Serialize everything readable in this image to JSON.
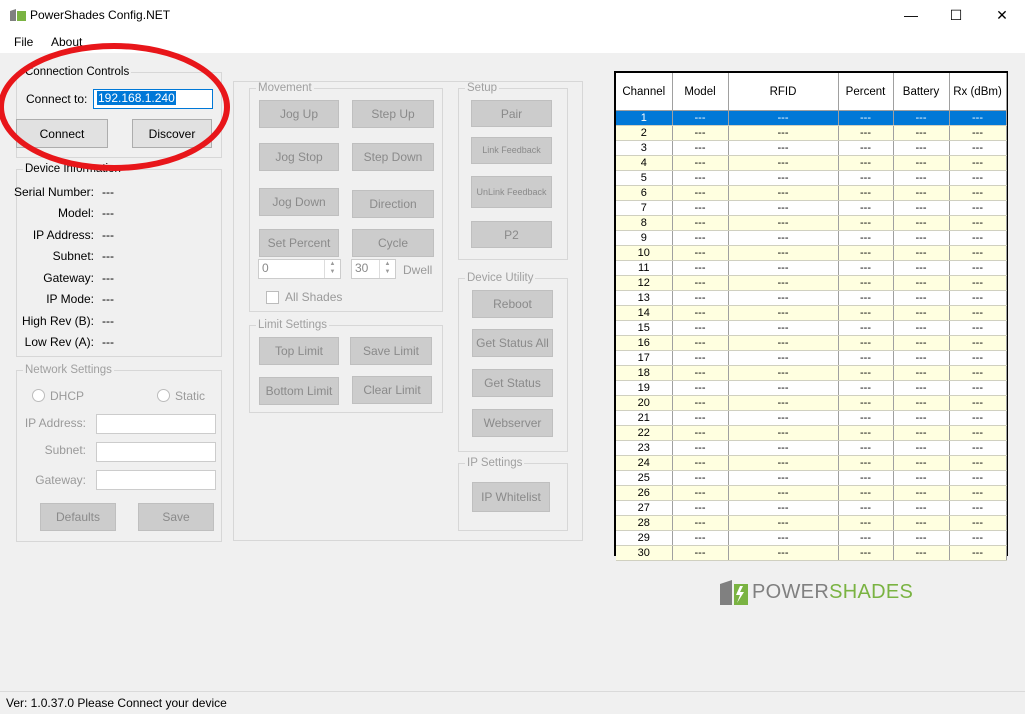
{
  "window": {
    "title": "PowerShades Config.NET",
    "minimize": "—",
    "maximize": "☐",
    "close": "✕"
  },
  "menu": {
    "file": "File",
    "about": "About"
  },
  "connection": {
    "legend": "Connection Controls",
    "connect_to_label": "Connect to:",
    "ip_value": "192.168.1.240",
    "connect_btn": "Connect",
    "discover_btn": "Discover"
  },
  "device_info": {
    "legend": "Device Information",
    "rows": [
      {
        "label": "Serial Number:",
        "value": "---"
      },
      {
        "label": "Model:",
        "value": "---"
      },
      {
        "label": "IP Address:",
        "value": "---"
      },
      {
        "label": "Subnet:",
        "value": "---"
      },
      {
        "label": "Gateway:",
        "value": "---"
      },
      {
        "label": "IP Mode:",
        "value": "---"
      },
      {
        "label": "High Rev (B):",
        "value": "---"
      },
      {
        "label": "Low Rev (A):",
        "value": "---"
      }
    ]
  },
  "network": {
    "legend": "Network Settings",
    "dhcp": "DHCP",
    "static": "Static",
    "ip_label": "IP Address:",
    "subnet_label": "Subnet:",
    "gateway_label": "Gateway:",
    "defaults_btn": "Defaults",
    "save_btn": "Save"
  },
  "movement": {
    "legend": "Movement",
    "jog_up": "Jog Up",
    "step_up": "Step Up",
    "jog_stop": "Jog Stop",
    "step_down": "Step Down",
    "jog_down": "Jog Down",
    "direction": "Direction",
    "set_percent": "Set Percent",
    "cycle": "Cycle",
    "percent_value": "0",
    "dwell_value": "30",
    "dwell_label": "Dwell",
    "all_shades": "All Shades"
  },
  "limits": {
    "legend": "Limit Settings",
    "top_limit": "Top Limit",
    "save_limit": "Save Limit",
    "bottom_limit": "Bottom Limit",
    "clear_limit": "Clear Limit"
  },
  "setup": {
    "legend": "Setup",
    "pair": "Pair",
    "link_feedback": "Link Feedback",
    "unlink_feedback": "UnLink Feedback",
    "p2": "P2"
  },
  "device_utility": {
    "legend": "Device Utility",
    "reboot": "Reboot",
    "get_status_all": "Get Status All",
    "get_status": "Get Status",
    "webserver": "Webserver"
  },
  "ip_settings": {
    "legend": "IP Settings",
    "ip_whitelist": "IP Whitelist"
  },
  "grid": {
    "columns": [
      "Channel",
      "Model",
      "RFID",
      "Percent",
      "Battery",
      "Rx (dBm)"
    ],
    "placeholder": "---",
    "selected_row": 1,
    "rows": [
      "1",
      "2",
      "3",
      "4",
      "5",
      "6",
      "7",
      "8",
      "9",
      "10",
      "11",
      "12",
      "13",
      "14",
      "15",
      "16",
      "17",
      "18",
      "19",
      "20",
      "21",
      "22",
      "23",
      "24",
      "25",
      "26",
      "27",
      "28",
      "29",
      "30"
    ]
  },
  "logo": {
    "part1": "POWER",
    "part2": "SHADES",
    "color_gray": "#808080",
    "color_green": "#7ab342"
  },
  "status": {
    "text": "Ver: 1.0.37.0  Please Connect your device"
  }
}
